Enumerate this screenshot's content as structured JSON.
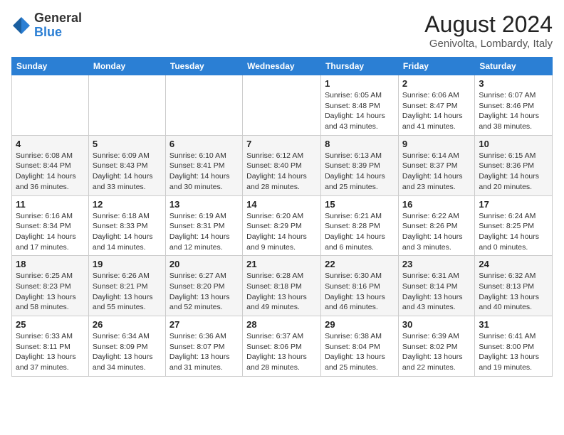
{
  "header": {
    "logo_general": "General",
    "logo_blue": "Blue",
    "month_title": "August 2024",
    "location": "Genivolta, Lombardy, Italy"
  },
  "days_of_week": [
    "Sunday",
    "Monday",
    "Tuesday",
    "Wednesday",
    "Thursday",
    "Friday",
    "Saturday"
  ],
  "weeks": [
    [
      {
        "day": "",
        "info": ""
      },
      {
        "day": "",
        "info": ""
      },
      {
        "day": "",
        "info": ""
      },
      {
        "day": "",
        "info": ""
      },
      {
        "day": "1",
        "info": "Sunrise: 6:05 AM\nSunset: 8:48 PM\nDaylight: 14 hours and 43 minutes."
      },
      {
        "day": "2",
        "info": "Sunrise: 6:06 AM\nSunset: 8:47 PM\nDaylight: 14 hours and 41 minutes."
      },
      {
        "day": "3",
        "info": "Sunrise: 6:07 AM\nSunset: 8:46 PM\nDaylight: 14 hours and 38 minutes."
      }
    ],
    [
      {
        "day": "4",
        "info": "Sunrise: 6:08 AM\nSunset: 8:44 PM\nDaylight: 14 hours and 36 minutes."
      },
      {
        "day": "5",
        "info": "Sunrise: 6:09 AM\nSunset: 8:43 PM\nDaylight: 14 hours and 33 minutes."
      },
      {
        "day": "6",
        "info": "Sunrise: 6:10 AM\nSunset: 8:41 PM\nDaylight: 14 hours and 30 minutes."
      },
      {
        "day": "7",
        "info": "Sunrise: 6:12 AM\nSunset: 8:40 PM\nDaylight: 14 hours and 28 minutes."
      },
      {
        "day": "8",
        "info": "Sunrise: 6:13 AM\nSunset: 8:39 PM\nDaylight: 14 hours and 25 minutes."
      },
      {
        "day": "9",
        "info": "Sunrise: 6:14 AM\nSunset: 8:37 PM\nDaylight: 14 hours and 23 minutes."
      },
      {
        "day": "10",
        "info": "Sunrise: 6:15 AM\nSunset: 8:36 PM\nDaylight: 14 hours and 20 minutes."
      }
    ],
    [
      {
        "day": "11",
        "info": "Sunrise: 6:16 AM\nSunset: 8:34 PM\nDaylight: 14 hours and 17 minutes."
      },
      {
        "day": "12",
        "info": "Sunrise: 6:18 AM\nSunset: 8:33 PM\nDaylight: 14 hours and 14 minutes."
      },
      {
        "day": "13",
        "info": "Sunrise: 6:19 AM\nSunset: 8:31 PM\nDaylight: 14 hours and 12 minutes."
      },
      {
        "day": "14",
        "info": "Sunrise: 6:20 AM\nSunset: 8:29 PM\nDaylight: 14 hours and 9 minutes."
      },
      {
        "day": "15",
        "info": "Sunrise: 6:21 AM\nSunset: 8:28 PM\nDaylight: 14 hours and 6 minutes."
      },
      {
        "day": "16",
        "info": "Sunrise: 6:22 AM\nSunset: 8:26 PM\nDaylight: 14 hours and 3 minutes."
      },
      {
        "day": "17",
        "info": "Sunrise: 6:24 AM\nSunset: 8:25 PM\nDaylight: 14 hours and 0 minutes."
      }
    ],
    [
      {
        "day": "18",
        "info": "Sunrise: 6:25 AM\nSunset: 8:23 PM\nDaylight: 13 hours and 58 minutes."
      },
      {
        "day": "19",
        "info": "Sunrise: 6:26 AM\nSunset: 8:21 PM\nDaylight: 13 hours and 55 minutes."
      },
      {
        "day": "20",
        "info": "Sunrise: 6:27 AM\nSunset: 8:20 PM\nDaylight: 13 hours and 52 minutes."
      },
      {
        "day": "21",
        "info": "Sunrise: 6:28 AM\nSunset: 8:18 PM\nDaylight: 13 hours and 49 minutes."
      },
      {
        "day": "22",
        "info": "Sunrise: 6:30 AM\nSunset: 8:16 PM\nDaylight: 13 hours and 46 minutes."
      },
      {
        "day": "23",
        "info": "Sunrise: 6:31 AM\nSunset: 8:14 PM\nDaylight: 13 hours and 43 minutes."
      },
      {
        "day": "24",
        "info": "Sunrise: 6:32 AM\nSunset: 8:13 PM\nDaylight: 13 hours and 40 minutes."
      }
    ],
    [
      {
        "day": "25",
        "info": "Sunrise: 6:33 AM\nSunset: 8:11 PM\nDaylight: 13 hours and 37 minutes."
      },
      {
        "day": "26",
        "info": "Sunrise: 6:34 AM\nSunset: 8:09 PM\nDaylight: 13 hours and 34 minutes."
      },
      {
        "day": "27",
        "info": "Sunrise: 6:36 AM\nSunset: 8:07 PM\nDaylight: 13 hours and 31 minutes."
      },
      {
        "day": "28",
        "info": "Sunrise: 6:37 AM\nSunset: 8:06 PM\nDaylight: 13 hours and 28 minutes."
      },
      {
        "day": "29",
        "info": "Sunrise: 6:38 AM\nSunset: 8:04 PM\nDaylight: 13 hours and 25 minutes."
      },
      {
        "day": "30",
        "info": "Sunrise: 6:39 AM\nSunset: 8:02 PM\nDaylight: 13 hours and 22 minutes."
      },
      {
        "day": "31",
        "info": "Sunrise: 6:41 AM\nSunset: 8:00 PM\nDaylight: 13 hours and 19 minutes."
      }
    ]
  ]
}
